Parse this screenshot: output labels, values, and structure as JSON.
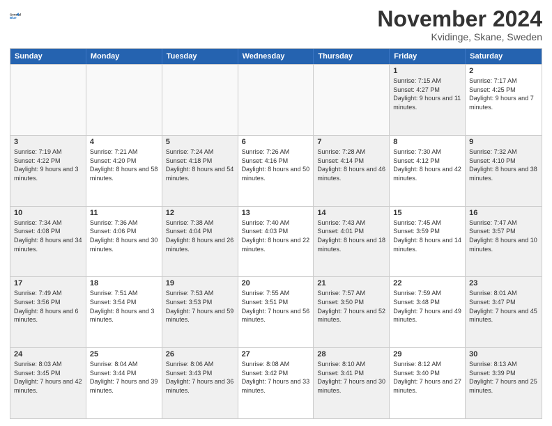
{
  "logo": {
    "line1": "General",
    "line2": "Blue"
  },
  "title": "November 2024",
  "location": "Kvidinge, Skane, Sweden",
  "days_of_week": [
    "Sunday",
    "Monday",
    "Tuesday",
    "Wednesday",
    "Thursday",
    "Friday",
    "Saturday"
  ],
  "weeks": [
    [
      {
        "day": "",
        "info": "",
        "empty": true
      },
      {
        "day": "",
        "info": "",
        "empty": true
      },
      {
        "day": "",
        "info": "",
        "empty": true
      },
      {
        "day": "",
        "info": "",
        "empty": true
      },
      {
        "day": "",
        "info": "",
        "empty": true
      },
      {
        "day": "1",
        "info": "Sunrise: 7:15 AM\nSunset: 4:27 PM\nDaylight: 9 hours and 11 minutes.",
        "empty": false,
        "shaded": true
      },
      {
        "day": "2",
        "info": "Sunrise: 7:17 AM\nSunset: 4:25 PM\nDaylight: 9 hours and 7 minutes.",
        "empty": false,
        "shaded": false
      }
    ],
    [
      {
        "day": "3",
        "info": "Sunrise: 7:19 AM\nSunset: 4:22 PM\nDaylight: 9 hours and 3 minutes.",
        "empty": false,
        "shaded": true
      },
      {
        "day": "4",
        "info": "Sunrise: 7:21 AM\nSunset: 4:20 PM\nDaylight: 8 hours and 58 minutes.",
        "empty": false,
        "shaded": false
      },
      {
        "day": "5",
        "info": "Sunrise: 7:24 AM\nSunset: 4:18 PM\nDaylight: 8 hours and 54 minutes.",
        "empty": false,
        "shaded": true
      },
      {
        "day": "6",
        "info": "Sunrise: 7:26 AM\nSunset: 4:16 PM\nDaylight: 8 hours and 50 minutes.",
        "empty": false,
        "shaded": false
      },
      {
        "day": "7",
        "info": "Sunrise: 7:28 AM\nSunset: 4:14 PM\nDaylight: 8 hours and 46 minutes.",
        "empty": false,
        "shaded": true
      },
      {
        "day": "8",
        "info": "Sunrise: 7:30 AM\nSunset: 4:12 PM\nDaylight: 8 hours and 42 minutes.",
        "empty": false,
        "shaded": false
      },
      {
        "day": "9",
        "info": "Sunrise: 7:32 AM\nSunset: 4:10 PM\nDaylight: 8 hours and 38 minutes.",
        "empty": false,
        "shaded": true
      }
    ],
    [
      {
        "day": "10",
        "info": "Sunrise: 7:34 AM\nSunset: 4:08 PM\nDaylight: 8 hours and 34 minutes.",
        "empty": false,
        "shaded": true
      },
      {
        "day": "11",
        "info": "Sunrise: 7:36 AM\nSunset: 4:06 PM\nDaylight: 8 hours and 30 minutes.",
        "empty": false,
        "shaded": false
      },
      {
        "day": "12",
        "info": "Sunrise: 7:38 AM\nSunset: 4:04 PM\nDaylight: 8 hours and 26 minutes.",
        "empty": false,
        "shaded": true
      },
      {
        "day": "13",
        "info": "Sunrise: 7:40 AM\nSunset: 4:03 PM\nDaylight: 8 hours and 22 minutes.",
        "empty": false,
        "shaded": false
      },
      {
        "day": "14",
        "info": "Sunrise: 7:43 AM\nSunset: 4:01 PM\nDaylight: 8 hours and 18 minutes.",
        "empty": false,
        "shaded": true
      },
      {
        "day": "15",
        "info": "Sunrise: 7:45 AM\nSunset: 3:59 PM\nDaylight: 8 hours and 14 minutes.",
        "empty": false,
        "shaded": false
      },
      {
        "day": "16",
        "info": "Sunrise: 7:47 AM\nSunset: 3:57 PM\nDaylight: 8 hours and 10 minutes.",
        "empty": false,
        "shaded": true
      }
    ],
    [
      {
        "day": "17",
        "info": "Sunrise: 7:49 AM\nSunset: 3:56 PM\nDaylight: 8 hours and 6 minutes.",
        "empty": false,
        "shaded": true
      },
      {
        "day": "18",
        "info": "Sunrise: 7:51 AM\nSunset: 3:54 PM\nDaylight: 8 hours and 3 minutes.",
        "empty": false,
        "shaded": false
      },
      {
        "day": "19",
        "info": "Sunrise: 7:53 AM\nSunset: 3:53 PM\nDaylight: 7 hours and 59 minutes.",
        "empty": false,
        "shaded": true
      },
      {
        "day": "20",
        "info": "Sunrise: 7:55 AM\nSunset: 3:51 PM\nDaylight: 7 hours and 56 minutes.",
        "empty": false,
        "shaded": false
      },
      {
        "day": "21",
        "info": "Sunrise: 7:57 AM\nSunset: 3:50 PM\nDaylight: 7 hours and 52 minutes.",
        "empty": false,
        "shaded": true
      },
      {
        "day": "22",
        "info": "Sunrise: 7:59 AM\nSunset: 3:48 PM\nDaylight: 7 hours and 49 minutes.",
        "empty": false,
        "shaded": false
      },
      {
        "day": "23",
        "info": "Sunrise: 8:01 AM\nSunset: 3:47 PM\nDaylight: 7 hours and 45 minutes.",
        "empty": false,
        "shaded": true
      }
    ],
    [
      {
        "day": "24",
        "info": "Sunrise: 8:03 AM\nSunset: 3:45 PM\nDaylight: 7 hours and 42 minutes.",
        "empty": false,
        "shaded": true
      },
      {
        "day": "25",
        "info": "Sunrise: 8:04 AM\nSunset: 3:44 PM\nDaylight: 7 hours and 39 minutes.",
        "empty": false,
        "shaded": false
      },
      {
        "day": "26",
        "info": "Sunrise: 8:06 AM\nSunset: 3:43 PM\nDaylight: 7 hours and 36 minutes.",
        "empty": false,
        "shaded": true
      },
      {
        "day": "27",
        "info": "Sunrise: 8:08 AM\nSunset: 3:42 PM\nDaylight: 7 hours and 33 minutes.",
        "empty": false,
        "shaded": false
      },
      {
        "day": "28",
        "info": "Sunrise: 8:10 AM\nSunset: 3:41 PM\nDaylight: 7 hours and 30 minutes.",
        "empty": false,
        "shaded": true
      },
      {
        "day": "29",
        "info": "Sunrise: 8:12 AM\nSunset: 3:40 PM\nDaylight: 7 hours and 27 minutes.",
        "empty": false,
        "shaded": false
      },
      {
        "day": "30",
        "info": "Sunrise: 8:13 AM\nSunset: 3:39 PM\nDaylight: 7 hours and 25 minutes.",
        "empty": false,
        "shaded": true
      }
    ]
  ]
}
